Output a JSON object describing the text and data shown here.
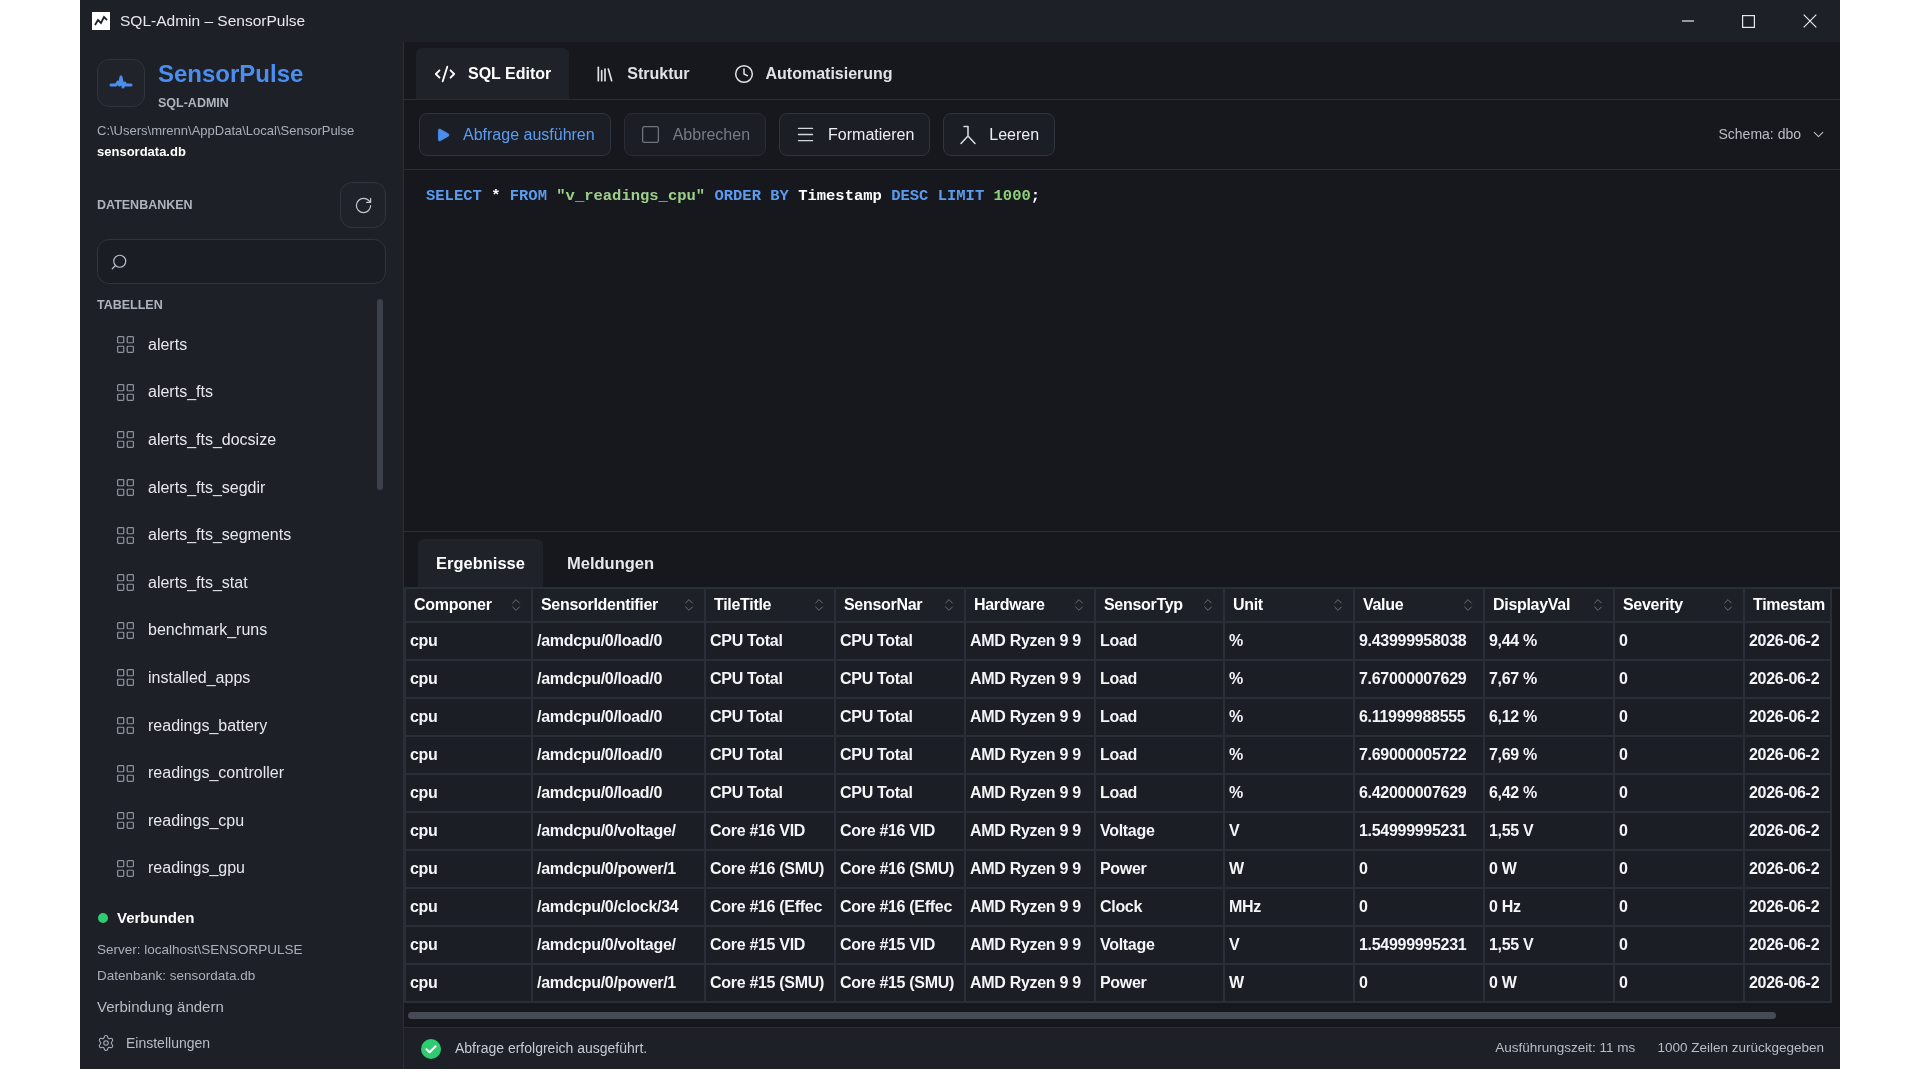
{
  "window": {
    "title": "SQL-Admin – SensorPulse"
  },
  "sidebar": {
    "app_name": "SensorPulse",
    "app_subtitle": "SQL-ADMIN",
    "db_path": "C:\\Users\\mrenn\\AppData\\Local\\SensorPulse",
    "db_file": "sensordata.db",
    "databases_heading": "DATENBANKEN",
    "tables_heading": "TABELLEN",
    "tables": [
      "alerts",
      "alerts_fts",
      "alerts_fts_docsize",
      "alerts_fts_segdir",
      "alerts_fts_segments",
      "alerts_fts_stat",
      "benchmark_runs",
      "installed_apps",
      "readings_battery",
      "readings_controller",
      "readings_cpu",
      "readings_gpu"
    ],
    "connection": {
      "status": "Verbunden",
      "connected": true,
      "server": "Server: localhost\\SENSORPULSE",
      "database": "Datenbank: sensordata.db"
    },
    "change_connection": "Verbindung ändern",
    "settings": "Einstellungen"
  },
  "tabs": [
    {
      "label": "SQL Editor",
      "kind": "editor",
      "selected": true
    },
    {
      "label": "Struktur",
      "kind": "structure",
      "selected": false
    },
    {
      "label": "Automatisierung",
      "kind": "automation",
      "selected": false
    }
  ],
  "toolbar": {
    "buttons": [
      {
        "label": "Abfrage ausführen",
        "kind": "run",
        "disabled": false
      },
      {
        "label": "Abbrechen",
        "kind": "cancel",
        "disabled": true
      },
      {
        "label": "Formatieren",
        "kind": "format",
        "disabled": false
      },
      {
        "label": "Leeren",
        "kind": "clear",
        "disabled": false
      }
    ],
    "schema": "Schema: dbo"
  },
  "editor": {
    "tokens": [
      {
        "text": "SELECT",
        "kind": "keyword"
      },
      {
        "text": "*",
        "kind": "operator"
      },
      {
        "text": "FROM",
        "kind": "keyword"
      },
      {
        "text": "\"v_readings_cpu\"",
        "kind": "string"
      },
      {
        "text": "ORDER BY",
        "kind": "keyword"
      },
      {
        "text": "Timestamp",
        "kind": "identifier"
      },
      {
        "text": "DESC",
        "kind": "keyword"
      },
      {
        "text": "LIMIT",
        "kind": "keyword"
      },
      {
        "text": "1000",
        "kind": "number"
      },
      {
        "text": ";",
        "kind": "punctuation"
      }
    ]
  },
  "results": {
    "tabs": [
      {
        "label": "Ergebnisse",
        "selected": true
      },
      {
        "label": "Meldungen",
        "selected": false
      }
    ],
    "table": {
      "columns": [
        {
          "label": "Componer",
          "sortable": true
        },
        {
          "label": "SensorIdentifier",
          "sortable": true
        },
        {
          "label": "TileTitle",
          "sortable": true
        },
        {
          "label": "SensorNar",
          "sortable": true
        },
        {
          "label": "Hardware",
          "sortable": true
        },
        {
          "label": "SensorTyp",
          "sortable": true
        },
        {
          "label": "Unit",
          "sortable": true
        },
        {
          "label": "Value",
          "sortable": true
        },
        {
          "label": "DisplayVal",
          "sortable": true
        },
        {
          "label": "Severity",
          "sortable": true
        },
        {
          "label": "Timestam",
          "sortable": false
        }
      ],
      "rows": [
        [
          "cpu",
          "/amdcpu/0/load/0",
          "CPU Total",
          "CPU Total",
          "AMD Ryzen 9 9",
          "Load",
          "%",
          "9.43999958038",
          "9,44 %",
          "0",
          "2026-06-2"
        ],
        [
          "cpu",
          "/amdcpu/0/load/0",
          "CPU Total",
          "CPU Total",
          "AMD Ryzen 9 9",
          "Load",
          "%",
          "7.67000007629",
          "7,67 %",
          "0",
          "2026-06-2"
        ],
        [
          "cpu",
          "/amdcpu/0/load/0",
          "CPU Total",
          "CPU Total",
          "AMD Ryzen 9 9",
          "Load",
          "%",
          "6.11999988555",
          "6,12 %",
          "0",
          "2026-06-2"
        ],
        [
          "cpu",
          "/amdcpu/0/load/0",
          "CPU Total",
          "CPU Total",
          "AMD Ryzen 9 9",
          "Load",
          "%",
          "7.69000005722",
          "7,69 %",
          "0",
          "2026-06-2"
        ],
        [
          "cpu",
          "/amdcpu/0/load/0",
          "CPU Total",
          "CPU Total",
          "AMD Ryzen 9 9",
          "Load",
          "%",
          "6.42000007629",
          "6,42 %",
          "0",
          "2026-06-2"
        ],
        [
          "cpu",
          "/amdcpu/0/voltage/",
          "Core #16 VID",
          "Core #16 VID",
          "AMD Ryzen 9 9",
          "Voltage",
          "V",
          "1.54999995231",
          "1,55 V",
          "0",
          "2026-06-2"
        ],
        [
          "cpu",
          "/amdcpu/0/power/1",
          "Core #16 (SMU)",
          "Core #16 (SMU)",
          "AMD Ryzen 9 9",
          "Power",
          "W",
          "0",
          "0 W",
          "0",
          "2026-06-2"
        ],
        [
          "cpu",
          "/amdcpu/0/clock/34",
          "Core #16 (Effec",
          "Core #16 (Effec",
          "AMD Ryzen 9 9",
          "Clock",
          "MHz",
          "0",
          "0 Hz",
          "0",
          "2026-06-2"
        ],
        [
          "cpu",
          "/amdcpu/0/voltage/",
          "Core #15 VID",
          "Core #15 VID",
          "AMD Ryzen 9 9",
          "Voltage",
          "V",
          "1.54999995231",
          "1,55 V",
          "0",
          "2026-06-2"
        ],
        [
          "cpu",
          "/amdcpu/0/power/1",
          "Core #15 (SMU)",
          "Core #15 (SMU)",
          "AMD Ryzen 9 9",
          "Power",
          "W",
          "0",
          "0 W",
          "0",
          "2026-06-2"
        ]
      ]
    }
  },
  "status_bar": {
    "message": "Abfrage erfolgreich ausgeführt.",
    "success": true,
    "execution_time": "Ausführungszeit: 11 ms",
    "row_count": "1000 Zeilen zurückgegeben"
  }
}
